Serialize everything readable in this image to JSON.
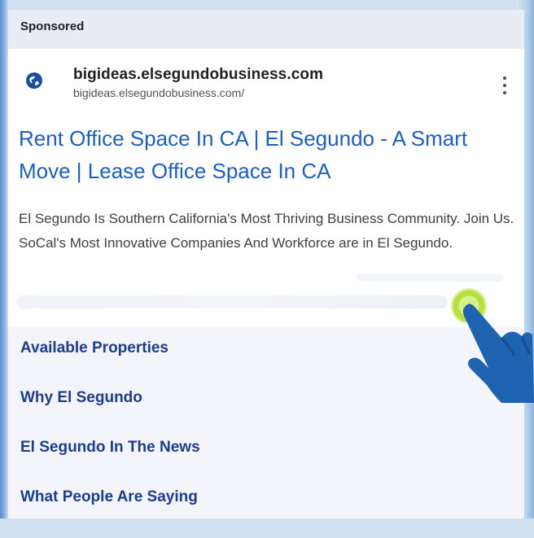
{
  "ad": {
    "sponsored_label": "Sponsored",
    "domain": "bigideas.elsegundobusiness.com",
    "url": "bigideas.elsegundobusiness.com/",
    "title": "Rent Office Space In CA | El Segundo - A Smart Move | Lease Office Space In CA",
    "description": "El Segundo Is Southern California's Most Thriving Business Community. Join Us. SoCal's Most Innovative Companies And Workforce are in El Segundo.",
    "icons": {
      "favicon": "globe-icon",
      "more": "more-vertical-icon",
      "pointer": "pointing-hand-icon"
    },
    "sitelinks": [
      {
        "label": "Available Properties"
      },
      {
        "label": "Why El Segundo"
      },
      {
        "label": "El Segundo In The News"
      },
      {
        "label": "What People Are Saying"
      }
    ]
  },
  "colors": {
    "link_blue": "#1a5ec9",
    "sitelink_navy": "#1c3d8f",
    "tap_highlight": "#b7e03c",
    "hand_blue": "#1e63b0"
  }
}
